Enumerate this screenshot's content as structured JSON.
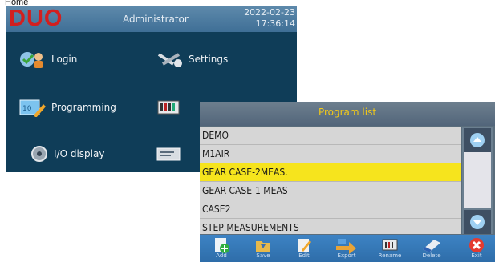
{
  "page_label": "Home",
  "header": {
    "logo": "DUO",
    "title": "Administrator",
    "date": "2022-02-23",
    "time": "17:36:14"
  },
  "menu": {
    "login": "Login",
    "settings": "Settings",
    "programming": "Programming",
    "io_display": "I/O display"
  },
  "dialog": {
    "title": "Program list",
    "items": [
      "DEMO",
      "M1AIR",
      "GEAR CASE-2MEAS.",
      "GEAR CASE-1 MEAS",
      "CASE2",
      "STEP-MEASUREMENTS"
    ],
    "selected_index": 2
  },
  "toolbar": {
    "add": "Add",
    "save": "Save",
    "edit": "Edit",
    "export": "Export",
    "rename": "Rename",
    "delete": "Delete",
    "exit": "Exit"
  },
  "colors": {
    "logo_red": "#d21f1f",
    "panel_bg": "#0f3d58",
    "selection": "#f6e41d",
    "dialog_title": "#f2c919"
  }
}
